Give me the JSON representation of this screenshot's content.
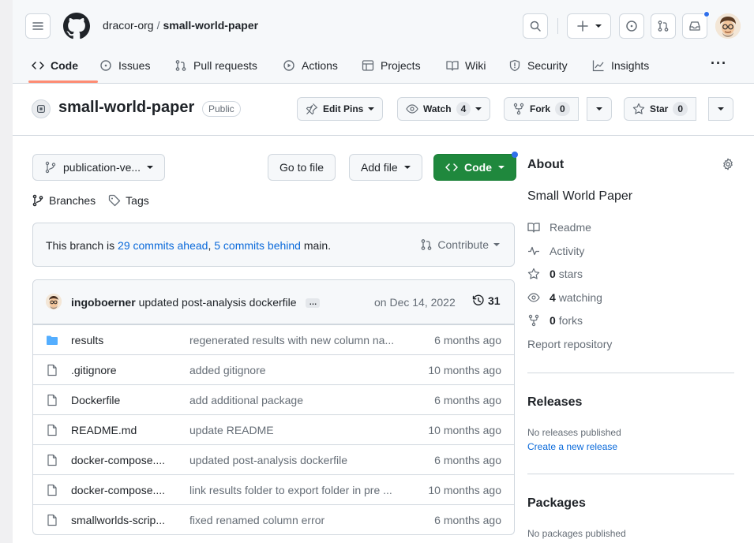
{
  "header": {
    "owner": "dracor-org",
    "separator": "/",
    "repo": "small-world-paper"
  },
  "tabs": [
    {
      "label": "Code",
      "icon": "code-icon"
    },
    {
      "label": "Issues",
      "icon": "issue-icon"
    },
    {
      "label": "Pull requests",
      "icon": "pull-request-icon"
    },
    {
      "label": "Actions",
      "icon": "play-icon"
    },
    {
      "label": "Projects",
      "icon": "table-icon"
    },
    {
      "label": "Wiki",
      "icon": "book-icon"
    },
    {
      "label": "Security",
      "icon": "shield-icon"
    },
    {
      "label": "Insights",
      "icon": "graph-icon"
    }
  ],
  "more_label": "···",
  "repo_header": {
    "name": "small-world-paper",
    "visibility": "Public",
    "edit_pins": "Edit Pins",
    "watch_label": "Watch",
    "watch_count": "4",
    "fork_label": "Fork",
    "fork_count": "0",
    "star_label": "Star",
    "star_count": "0"
  },
  "toolbar": {
    "branch": "publication-ve...",
    "go_to_file": "Go to file",
    "add_file": "Add file",
    "code": "Code",
    "branches": "Branches",
    "tags": "Tags"
  },
  "branch_info": {
    "prefix": "This branch is ",
    "ahead": "29 commits ahead",
    "comma": ", ",
    "behind": "5 commits behind",
    "suffix": " main.",
    "contribute": "Contribute"
  },
  "latest_commit": {
    "author": "ingoboerner",
    "message": "updated post-analysis dockerfile",
    "ellipsis": "…",
    "date": "on Dec 14, 2022",
    "count": "31"
  },
  "files": [
    {
      "name": "results",
      "type": "folder",
      "message": "regenerated results with new column na...",
      "age": "6 months ago"
    },
    {
      "name": ".gitignore",
      "type": "file",
      "message": "added gitignore",
      "age": "10 months ago"
    },
    {
      "name": "Dockerfile",
      "type": "file",
      "message": "add additional package",
      "age": "6 months ago"
    },
    {
      "name": "README.md",
      "type": "file",
      "message": "update README",
      "age": "10 months ago"
    },
    {
      "name": "docker-compose....",
      "type": "file",
      "message": "updated post-analysis dockerfile",
      "age": "6 months ago"
    },
    {
      "name": "docker-compose....",
      "type": "file",
      "message": "link results folder to export folder in pre ...",
      "age": "10 months ago"
    },
    {
      "name": "smallworlds-scrip...",
      "type": "file",
      "message": "fixed renamed column error",
      "age": "6 months ago"
    }
  ],
  "about": {
    "title": "About",
    "description": "Small World Paper",
    "readme": "Readme",
    "activity": "Activity",
    "stars_count": "0",
    "stars_label": "stars",
    "watching_count": "4",
    "watching_label": "watching",
    "forks_count": "0",
    "forks_label": "forks",
    "report": "Report repository"
  },
  "releases": {
    "title": "Releases",
    "none": "No releases published",
    "create": "Create a new release"
  },
  "packages": {
    "title": "Packages",
    "none": "No packages published"
  },
  "colors": {
    "accent": "#0969da",
    "code_button": "#1f883d",
    "tab_underline": "#fd8c73",
    "notification": "#2f6feb"
  }
}
